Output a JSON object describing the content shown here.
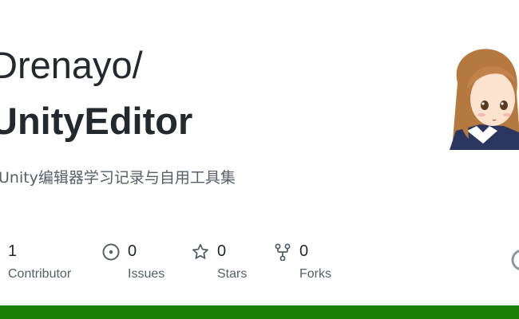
{
  "owner": "Drenayo/",
  "repo": "UnityEditor",
  "description": "Unity编辑器学习记录与自用工具集",
  "stats": [
    {
      "value": "1",
      "label": "Contributor",
      "icon": "people-icon"
    },
    {
      "value": "0",
      "label": "Issues",
      "icon": "issue-icon"
    },
    {
      "value": "0",
      "label": "Stars",
      "icon": "star-icon"
    },
    {
      "value": "0",
      "label": "Forks",
      "icon": "fork-icon"
    }
  ],
  "colors": {
    "text": "#24292f",
    "muted": "#57606a",
    "language_bar": "#1a7f06"
  }
}
